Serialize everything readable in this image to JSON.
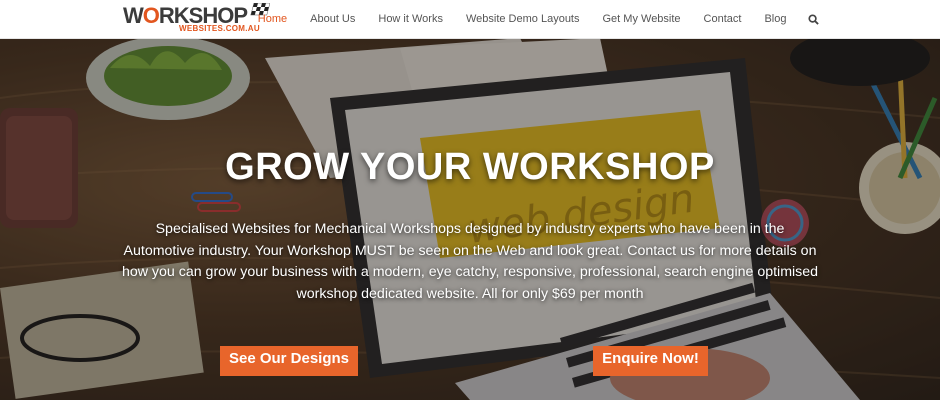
{
  "logo": {
    "main_prefix": "W",
    "main_o": "O",
    "main_rest": "RKSHOP",
    "sub": "WEBSITES.COM.AU"
  },
  "nav": {
    "items": [
      {
        "label": "Home",
        "active": true
      },
      {
        "label": "About Us"
      },
      {
        "label": "How it Works"
      },
      {
        "label": "Website Demo Layouts"
      },
      {
        "label": "Get My Website"
      },
      {
        "label": "Contact"
      },
      {
        "label": "Blog"
      }
    ],
    "search_icon": "search-icon"
  },
  "hero": {
    "title": "GROW YOUR WORKSHOP",
    "text": "Specialised Websites for Mechanical Workshops designed by industry experts who have been in the Automotive industry. Your Workshop MUST be seen on the Web and look great. Contact us for more details on how you can grow your business with a modern, eye catchy, responsive, professional, search engine optimised workshop dedicated website. All for only $69 per month",
    "button_designs": "See Our Designs",
    "button_enquire": "Enquire Now!",
    "laptop_screen_text": "web design"
  },
  "colors": {
    "accent": "#e2561f",
    "button": "#e8652b"
  }
}
